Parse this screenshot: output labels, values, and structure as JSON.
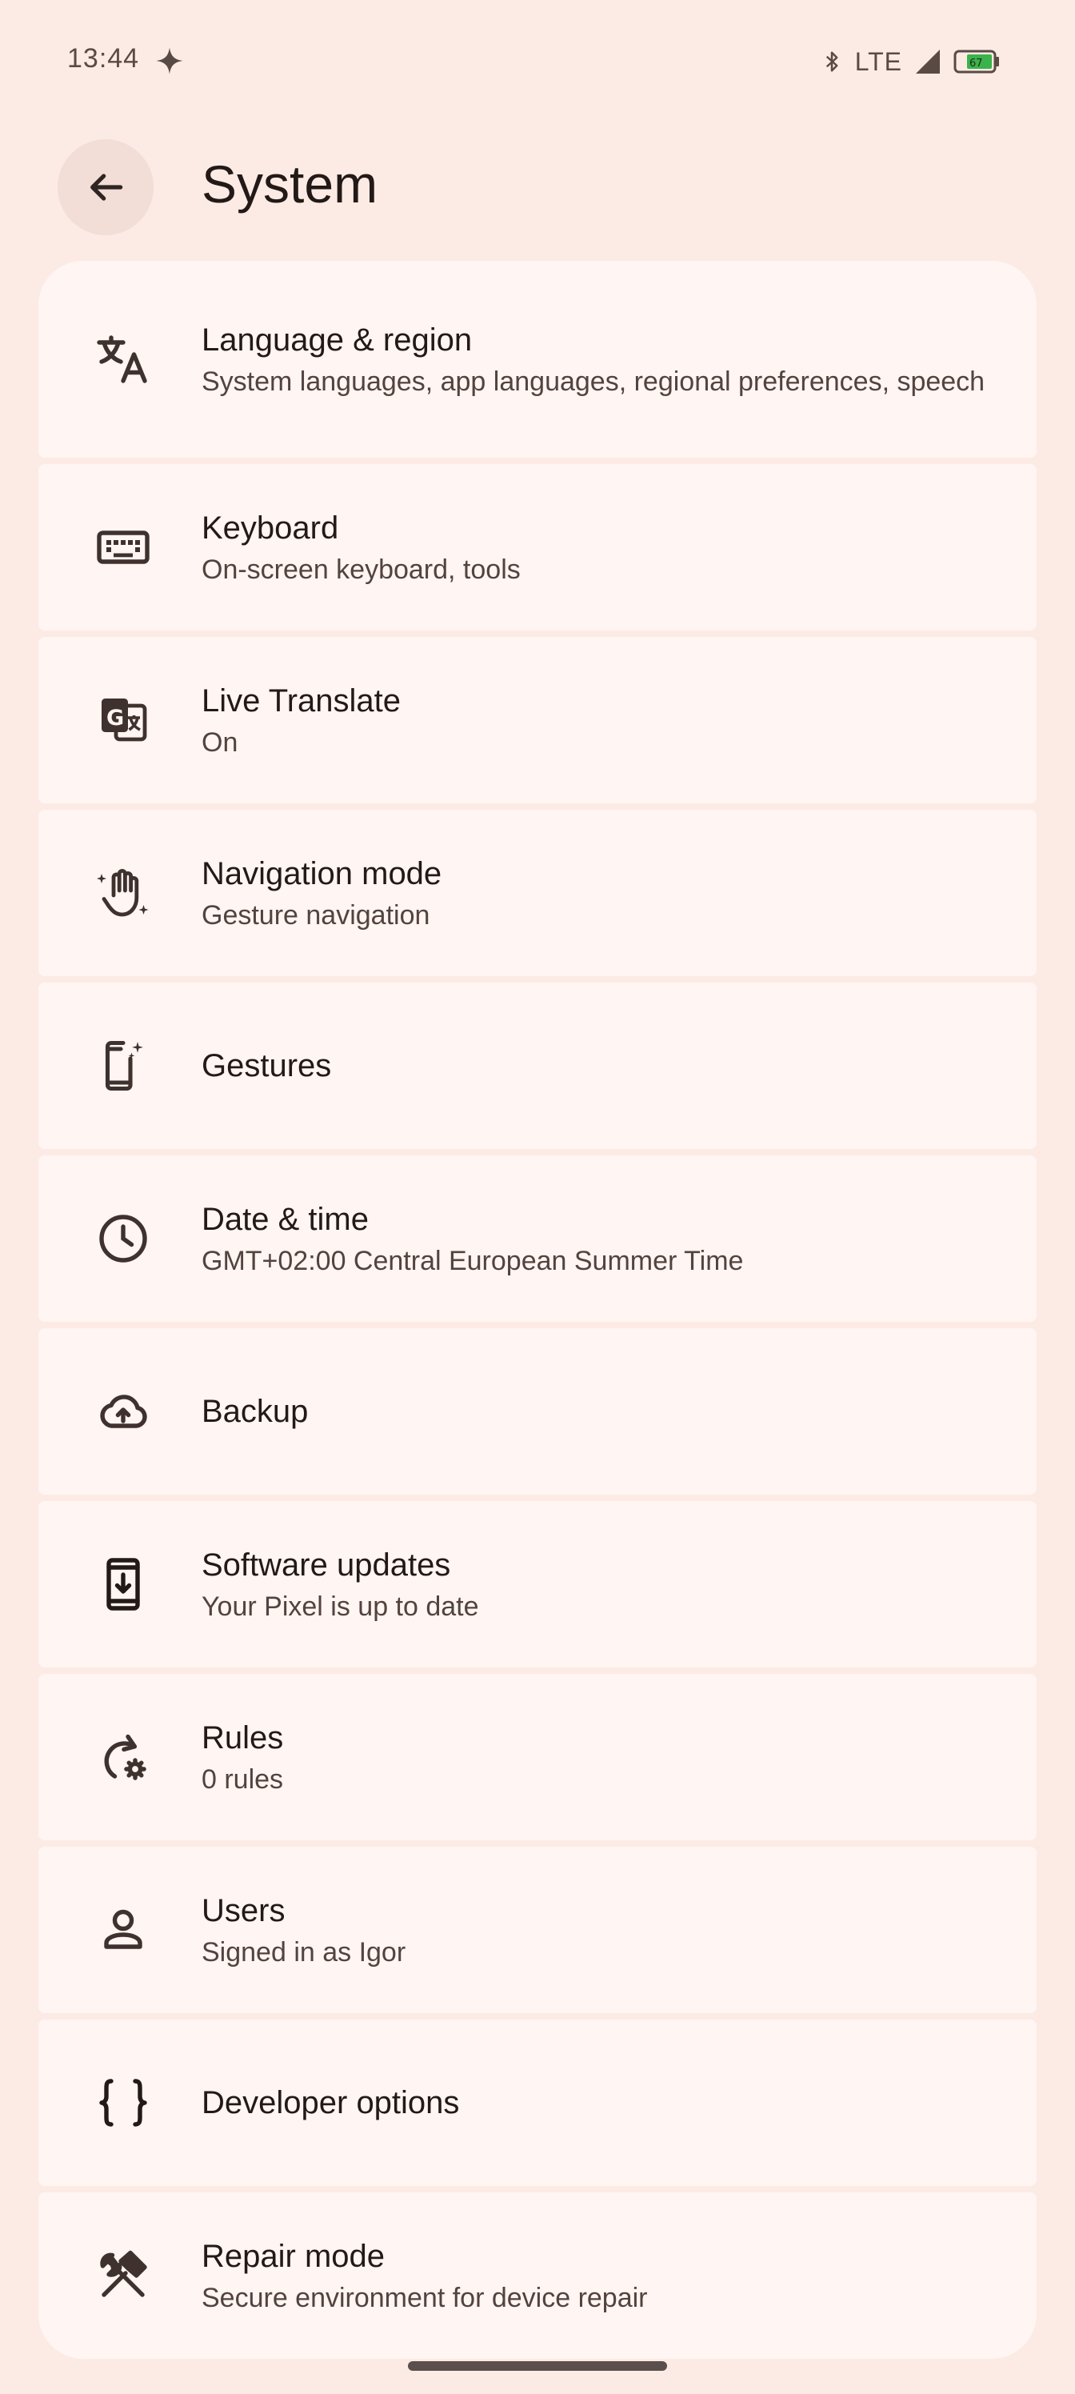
{
  "status_bar": {
    "time": "13:44",
    "network": "LTE",
    "battery_level": "67"
  },
  "app_bar": {
    "title": "System",
    "back_icon": "arrow-back-icon"
  },
  "items": [
    {
      "title": "Language & region",
      "subtitle": "System languages, app languages, regional preferences, speech",
      "icon": "translate-icon"
    },
    {
      "title": "Keyboard",
      "subtitle": "On-screen keyboard, tools",
      "icon": "keyboard-icon"
    },
    {
      "title": "Live Translate",
      "subtitle": "On",
      "icon": "live-translate-icon"
    },
    {
      "title": "Navigation mode",
      "subtitle": "Gesture navigation",
      "icon": "gesture-hand-icon"
    },
    {
      "title": "Gestures",
      "subtitle": "",
      "icon": "phone-sparkle-icon"
    },
    {
      "title": "Date & time",
      "subtitle": "GMT+02:00 Central European Summer Time",
      "icon": "clock-icon"
    },
    {
      "title": "Backup",
      "subtitle": "",
      "icon": "cloud-upload-icon"
    },
    {
      "title": "Software updates",
      "subtitle": "Your Pixel is up to date",
      "icon": "system-update-icon"
    },
    {
      "title": "Rules",
      "subtitle": "0 rules",
      "icon": "rules-icon"
    },
    {
      "title": "Users",
      "subtitle": "Signed in as Igor",
      "icon": "person-icon"
    },
    {
      "title": "Developer options",
      "subtitle": "",
      "icon": "braces-icon"
    },
    {
      "title": "Repair mode",
      "subtitle": "Secure environment for device repair",
      "icon": "repair-tools-icon"
    }
  ]
}
